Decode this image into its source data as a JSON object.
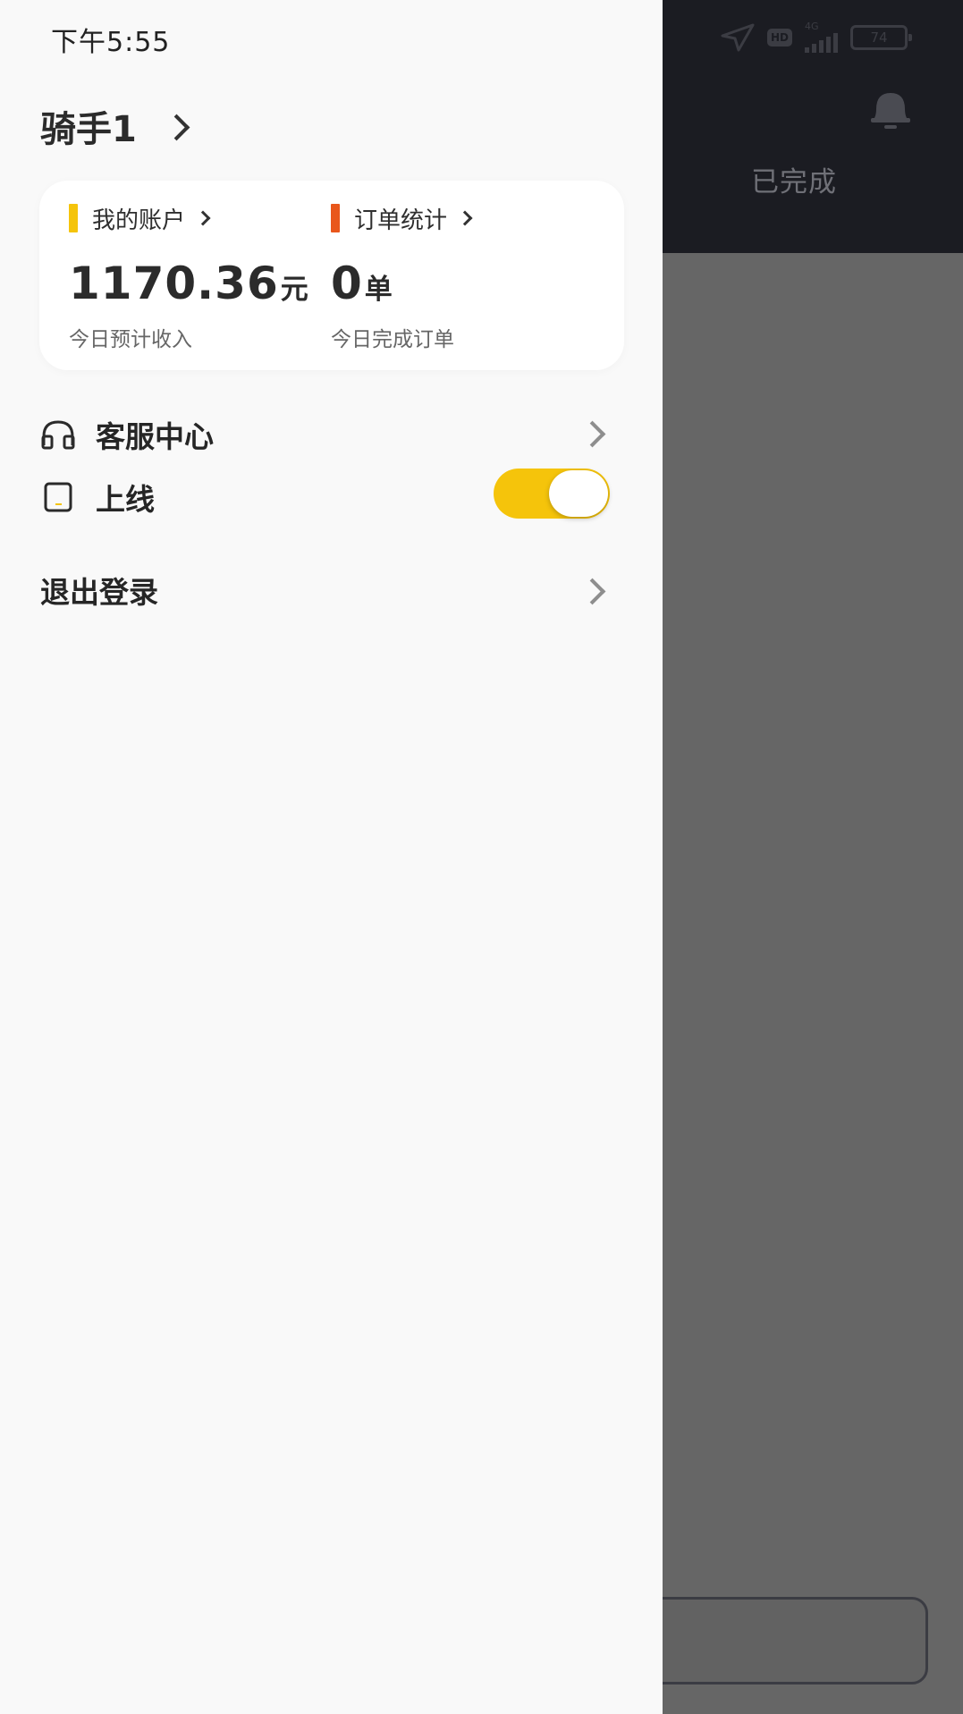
{
  "status_bar": {
    "time": "下午5:55",
    "hd_label": "HD",
    "network_label": "4G",
    "battery_level": "74"
  },
  "background": {
    "tab_label": "已完成"
  },
  "drawer": {
    "user_name": "骑手1",
    "account": {
      "title": "我的账户",
      "value": "1170.36",
      "unit": "元",
      "caption": "今日预计收入",
      "accent_color": "#F5C40B"
    },
    "orders": {
      "title": "订单统计",
      "value": "0",
      "unit": "单",
      "caption": "今日完成订单",
      "accent_color": "#E9571B"
    },
    "menu": {
      "customer_service": {
        "label": "客服中心",
        "icon": "headphones-icon"
      },
      "online": {
        "label": "上线",
        "icon": "tablet-icon",
        "enabled": true,
        "toggle_color": "#F5C40B"
      },
      "logout": {
        "label": "退出登录"
      }
    }
  }
}
